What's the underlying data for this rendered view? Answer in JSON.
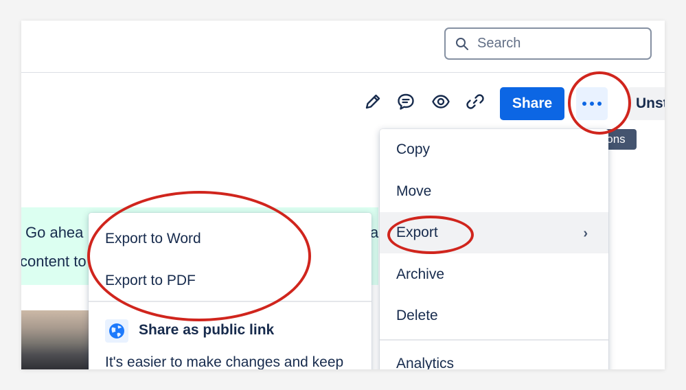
{
  "search": {
    "placeholder": "Search"
  },
  "toolbar": {
    "edit_icon": "pencil-icon",
    "comment_icon": "comment-icon",
    "watch_icon": "eye-icon",
    "link_icon": "link-icon",
    "share_label": "Share",
    "more_icon": "more-dots-icon",
    "unstar_label": "Unst",
    "tooltip": "More actions"
  },
  "banner": {
    "line1": "Go ahea",
    "line1_end": "a",
    "line2": "content to"
  },
  "menu": {
    "items": [
      {
        "label": "Copy"
      },
      {
        "label": "Move"
      },
      {
        "label": "Export",
        "has_submenu": true
      },
      {
        "label": "Archive"
      },
      {
        "label": "Delete"
      },
      {
        "label": "Analytics"
      }
    ],
    "chevron": "›"
  },
  "submenu": {
    "items": [
      {
        "label": "Export to Word"
      },
      {
        "label": "Export to PDF"
      }
    ],
    "public_link_title": "Share as public link",
    "public_link_desc": "It's easier to make changes and keep"
  },
  "colors": {
    "accent": "#0c66e4",
    "annotation": "#d0251d",
    "banner": "#dcfff1",
    "tooltip": "#44546f"
  }
}
